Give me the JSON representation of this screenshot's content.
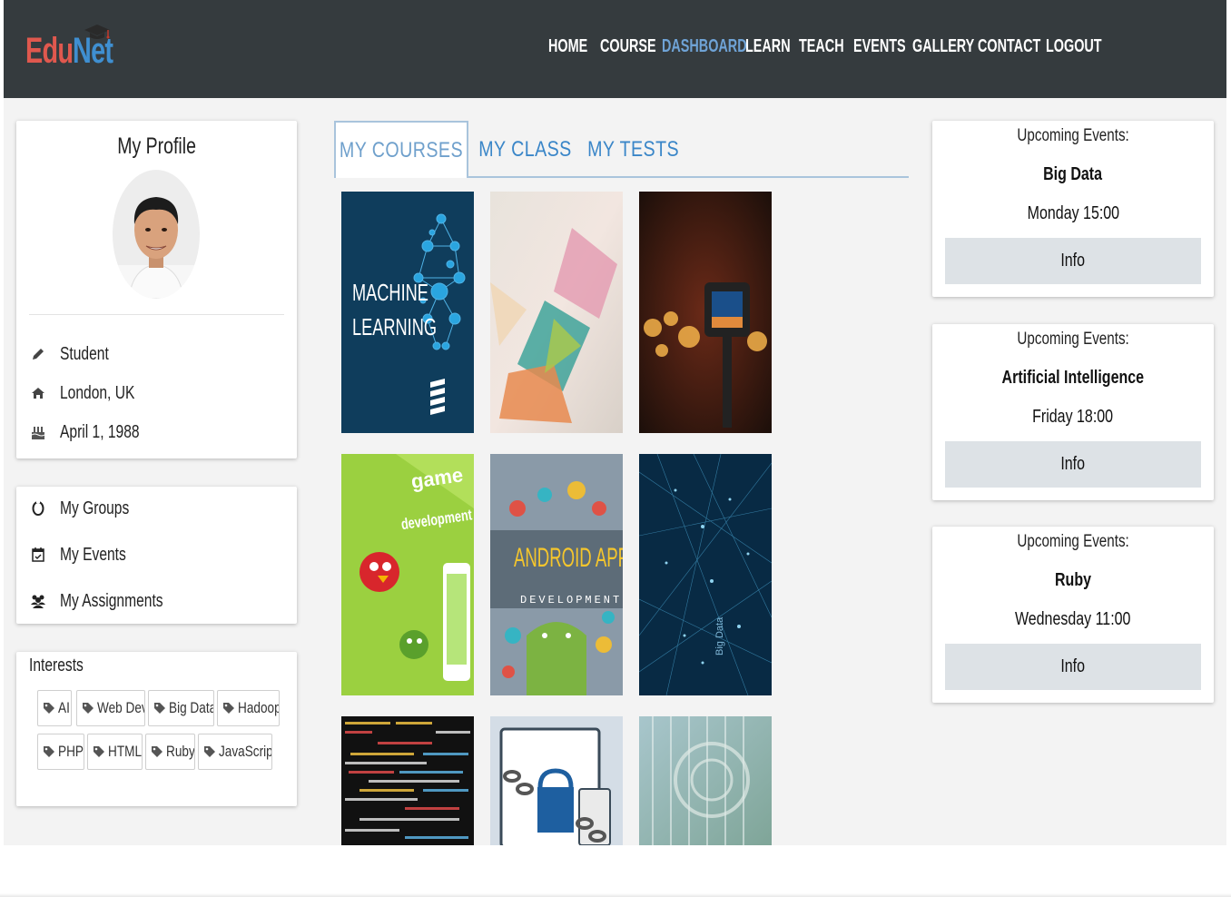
{
  "brand": {
    "part1": "Edu",
    "part2": "Net",
    "color1": "#e0584e",
    "color2": "#3f8fd1"
  },
  "nav": {
    "items": [
      {
        "label": "HOME"
      },
      {
        "label": "COURSE"
      },
      {
        "label": "DASHBOARD",
        "active": true
      },
      {
        "label": "LEARN"
      },
      {
        "label": "TEACH"
      },
      {
        "label": "EVENTS"
      },
      {
        "label": "GALLERY"
      },
      {
        "label": "CONTACT"
      },
      {
        "label": "LOGOUT"
      }
    ]
  },
  "profile": {
    "title": "My Profile",
    "role": "Student",
    "location": "London, UK",
    "birthday": "April 1, 1988"
  },
  "links": {
    "groups": "My Groups",
    "events": "My Events",
    "assignments": "My Assignments"
  },
  "interests": {
    "title": "Interests",
    "tags": [
      "AI",
      "Web Dev",
      "Big Data",
      "Hadoop",
      "PHP",
      "HTML",
      "Ruby",
      "JavaScript"
    ]
  },
  "tabs": [
    {
      "label": "MY COURSES",
      "active": true
    },
    {
      "label": "MY CLASS"
    },
    {
      "label": "MY TESTS"
    }
  ],
  "courses": {
    "ml_line1": "MACHINE",
    "ml_line2": "LEARNING",
    "game_line1": "game",
    "game_line2": "development",
    "android_line1": "ANDROID APP",
    "android_line2": "DEVELOPMENT",
    "bigdata_label": "Big Data"
  },
  "events": [
    {
      "label": "Upcoming Events:",
      "name": "Big Data",
      "time": "Monday 15:00",
      "button": "Info"
    },
    {
      "label": "Upcoming Events:",
      "name": "Artificial Intelligence",
      "time": "Friday 18:00",
      "button": "Info"
    },
    {
      "label": "Upcoming Events:",
      "name": "Ruby",
      "time": "Wednesday 11:00",
      "button": "Info"
    }
  ],
  "colors": {
    "navbar": "#353b3e",
    "accent": "#3a86c8",
    "active_nav": "#6fa3d6",
    "info_button": "#dde2e6"
  }
}
